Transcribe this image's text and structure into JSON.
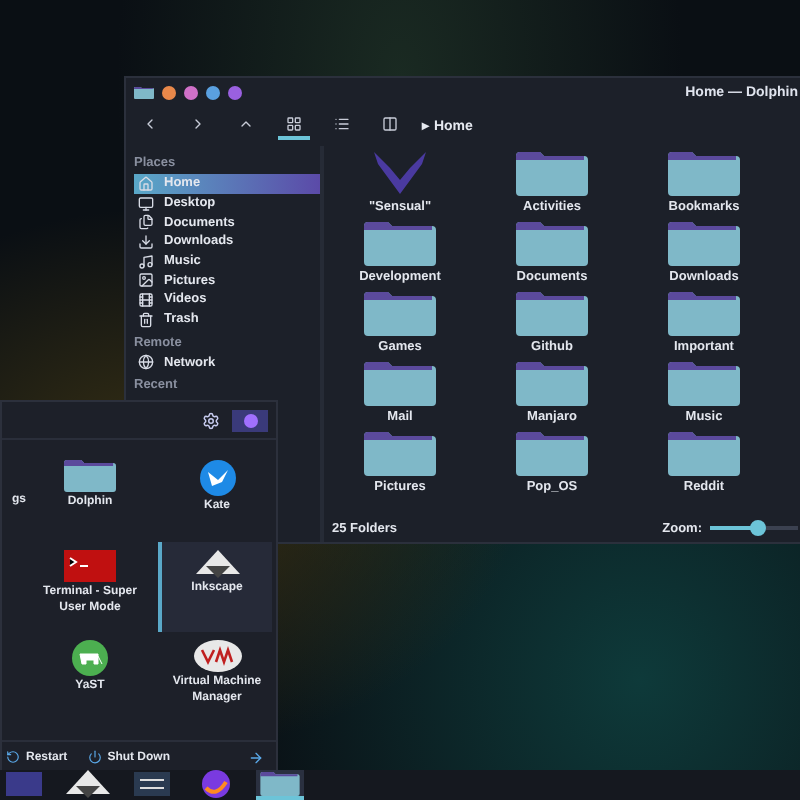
{
  "dolphin": {
    "title": "Home — Dolphin",
    "breadcrumb": "Home",
    "places": [
      {
        "heading": "Places",
        "items": [
          {
            "label": "Home",
            "kind": "home",
            "selected": true
          },
          {
            "label": "Desktop",
            "kind": "desktop",
            "selected": false
          },
          {
            "label": "Documents",
            "kind": "documents",
            "selected": false
          },
          {
            "label": "Downloads",
            "kind": "downloads",
            "selected": false
          },
          {
            "label": "Music",
            "kind": "music",
            "selected": false
          },
          {
            "label": "Pictures",
            "kind": "pictures",
            "selected": false
          },
          {
            "label": "Videos",
            "kind": "videos",
            "selected": false
          },
          {
            "label": "Trash",
            "kind": "trash",
            "selected": false
          }
        ]
      },
      {
        "heading": "Remote",
        "items": [
          {
            "label": "Network",
            "kind": "network",
            "selected": false
          }
        ]
      },
      {
        "heading": "Recent"
      }
    ],
    "separator": "▸",
    "folders": [
      {
        "name": "\"Sensual\"",
        "kind": "logo"
      },
      {
        "name": "Activities",
        "kind": "folder"
      },
      {
        "name": "Bookmarks",
        "kind": "folder"
      },
      {
        "name": "Development",
        "kind": "folder"
      },
      {
        "name": "Documents",
        "kind": "folder"
      },
      {
        "name": "Downloads",
        "kind": "folder"
      },
      {
        "name": "Games",
        "kind": "folder"
      },
      {
        "name": "Github",
        "kind": "folder"
      },
      {
        "name": "Important",
        "kind": "folder"
      },
      {
        "name": "Mail",
        "kind": "folder"
      },
      {
        "name": "Manjaro",
        "kind": "folder"
      },
      {
        "name": "Music",
        "kind": "folder"
      },
      {
        "name": "Pictures",
        "kind": "folder"
      },
      {
        "name": "Pop_OS",
        "kind": "folder"
      },
      {
        "name": "Reddit",
        "kind": "folder"
      }
    ],
    "status": "25 Folders",
    "zoom": {
      "label": "Zoom:",
      "level": 0.55
    }
  },
  "launcher": {
    "partial_label": "gs",
    "apps": [
      {
        "name": "Dolphin",
        "kind": "files",
        "selected": false
      },
      {
        "name": "Kate",
        "kind": "editor",
        "selected": false
      },
      {
        "name": "Terminal - Super User Mode",
        "kind": "terminal",
        "selected": false
      },
      {
        "name": "Inkscape",
        "kind": "vector",
        "selected": true
      },
      {
        "name": "YaST",
        "kind": "package",
        "selected": false
      },
      {
        "name": "Virtual Machine Manager",
        "kind": "vm",
        "selected": false
      }
    ],
    "actions": [
      {
        "label": "Restart",
        "kind": "restart"
      },
      {
        "label": "Shut Down",
        "kind": "shutdown"
      }
    ]
  },
  "taskbar": [
    {
      "kind": "window",
      "selected": false
    },
    {
      "kind": "vector",
      "selected": false
    },
    {
      "kind": "settings",
      "selected": false
    },
    {
      "kind": "browser",
      "selected": false
    },
    {
      "kind": "files",
      "selected": true
    }
  ]
}
